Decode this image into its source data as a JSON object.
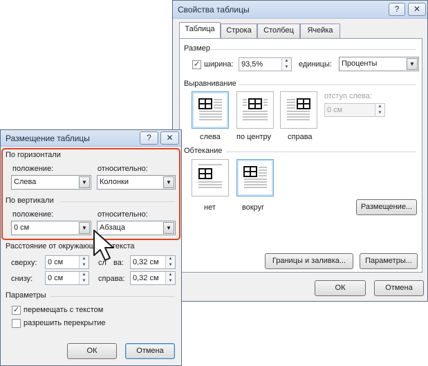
{
  "table_props": {
    "title": "Свойства таблицы",
    "help_btn": "?",
    "close_btn": "✕",
    "tabs": [
      "Таблица",
      "Строка",
      "Столбец",
      "Ячейка"
    ],
    "size_group": "Размер",
    "width_label": "ширина:",
    "width_value": "93,5%",
    "units_label": "единицы:",
    "units_value": "Проценты",
    "alignment_group": "Выравнивание",
    "indent_label": "отступ слева:",
    "indent_value": "0 см",
    "align_left": "слева",
    "align_center": "по центру",
    "align_right": "справа",
    "wrap_group": "Обтекание",
    "wrap_none": "нет",
    "wrap_around": "вокруг",
    "positioning_btn": "Размещение...",
    "borders_btn": "Границы и заливка...",
    "params_btn": "Параметры...",
    "ok": "ОК",
    "cancel": "Отмена"
  },
  "positioning": {
    "title": "Размещение таблицы",
    "help_btn": "?",
    "close_btn": "✕",
    "horizontal_group": "По горизонтали",
    "h_position_label": "положение:",
    "h_position_value": "Слева",
    "h_relative_label": "относительно:",
    "h_relative_value": "Колонки",
    "vertical_group": "По вертикали",
    "v_position_label": "положение:",
    "v_position_value": "0 см",
    "v_relative_label": "относительно:",
    "v_relative_value": "Абзаца",
    "distance_group_left": "Расстояние от окружающ",
    "distance_group_right": "текста",
    "top_label": "сверху:",
    "top_value": "0 см",
    "bottom_label": "снизу:",
    "bottom_value": "0 см",
    "left_label_a": "сл",
    "left_label_b": "ва:",
    "left_value": "0,32 см",
    "right_label": "справа:",
    "right_value": "0,32 см",
    "params_group": "Параметры",
    "move_with_text": "перемещать с текстом",
    "allow_overlap": "разрешить перекрытие",
    "ok": "ОК",
    "cancel": "Отмена"
  },
  "colors": {
    "highlight": "#e0421d",
    "title_bar": "#c5d6ee",
    "selected_tile": "#6aa5d9"
  }
}
